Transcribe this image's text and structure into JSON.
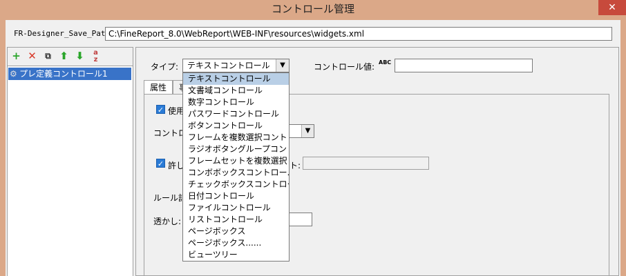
{
  "window": {
    "title": "コントロール管理",
    "close_glyph": "✕"
  },
  "path": {
    "label": "FR-Designer_Save_Path:",
    "value": "C:\\FineReport_8.0\\WebReport\\WEB-INF\\resources\\widgets.xml"
  },
  "toolbar": {
    "icons": [
      "add-icon",
      "delete-icon",
      "copy-icon",
      "move-up-icon",
      "move-down-icon",
      "sort-az-icon"
    ]
  },
  "tree": {
    "items": [
      {
        "label": "プレ定義コントロール1",
        "icon": "gear-icon"
      }
    ]
  },
  "form": {
    "type_label": "タイプ:",
    "type_value": "テキストコントロール",
    "value_label": "コントロール値:",
    "value_icon": "abc-icon",
    "value_icon_text": "ABC"
  },
  "tabs": [
    "属性",
    "事"
  ],
  "props": {
    "use_label": "使用",
    "control_label": "コントロ",
    "allow_label": "許し",
    "hint_suffix": "ト:",
    "rule_label": "ルール記",
    "watermark_label": "透かし:"
  },
  "dropdown": {
    "options": [
      "テキストコントロール",
      "文書域コントロール",
      "数字コントロール",
      "パスワードコントロール",
      "ボタンコントロール",
      "フレームを複数選択コント",
      "ラジオボタングループコン",
      "フレームセットを複数選択",
      "コンボボックスコントロール",
      "チェックボックスコントロー",
      "日付コントロール",
      "ファイルコントロール",
      "リストコントロール",
      "ページボックス",
      "ページボックス......",
      "ビューツリー"
    ],
    "selected_index": 0
  },
  "colors": {
    "titlebar": "#dba888",
    "selection": "#3973c8",
    "close": "#c74a3c"
  }
}
